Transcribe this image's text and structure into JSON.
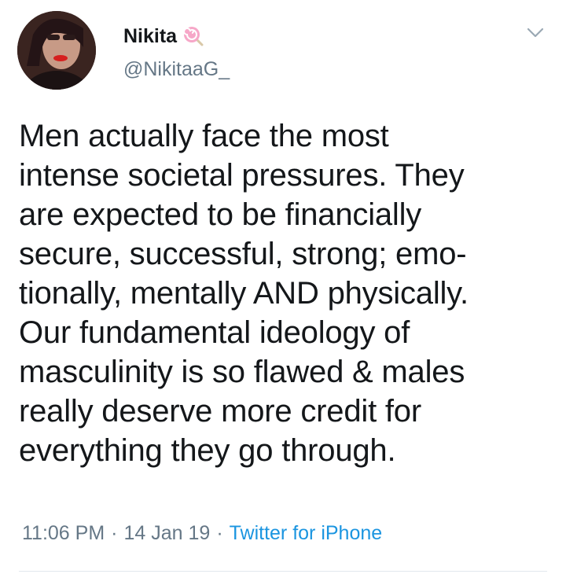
{
  "user": {
    "display_name": "Nikita",
    "handle": "@NikitaaG_",
    "name_emoji": "lollipop-icon"
  },
  "tweet": {
    "text": "Men actually face the most\nintense societal pressures. They\nare expected to be financially\nsecure, successful, strong; emo-\ntionally, mentally AND physically.\nOur fundamental ideology of\nmasculinity is so flawed & males\nreally deserve more credit for\neverything they go through.",
    "time": "11:06 PM",
    "separator": "·",
    "date": "14 Jan 19",
    "source": "Twitter for iPhone"
  },
  "icons": {
    "menu": "chevron-down-icon",
    "avatar": "avatar"
  },
  "colors": {
    "text_primary": "#14171a",
    "text_secondary": "#657786",
    "link": "#1b95e0",
    "divider": "#e1e8ed"
  }
}
